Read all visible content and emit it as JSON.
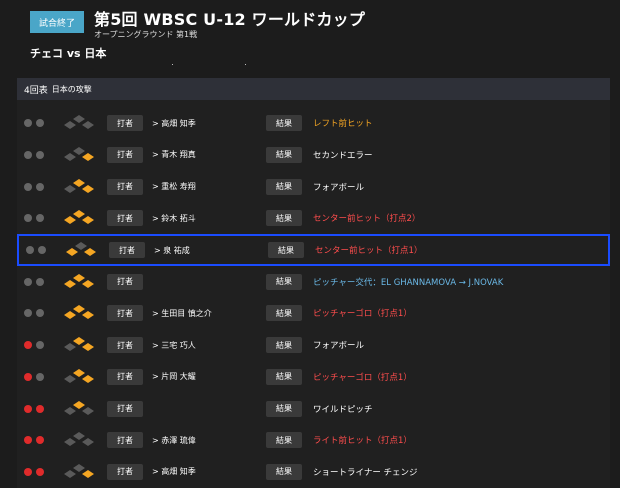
{
  "header": {
    "status": "試合終了",
    "title": "第5回 WBSC U-12 ワールドカップ",
    "subtitle": "オープニングラウンド 第1戦",
    "matchup": "チェコ vs 日本"
  },
  "section": {
    "inning": "4回表",
    "attack": "日本の攻撃"
  },
  "labels": {
    "batter": "打者",
    "result": "結果"
  },
  "colors": {
    "hit_orange": "#f5a623",
    "red_text": "#ff4d4d",
    "blue_text": "#6ab8e6",
    "white_text": "#ffffff",
    "base_on": "#f5a623",
    "base_off": "#5a5a5a",
    "out_on": "#e02b2b",
    "out_off": "#666666"
  },
  "rows": [
    {
      "outs": 0,
      "bases": [
        0,
        0,
        0
      ],
      "batter": "> 高畑 知季",
      "result": "レフト前ヒット",
      "result_color": "#f5a623"
    },
    {
      "outs": 0,
      "bases": [
        1,
        0,
        0
      ],
      "batter": "> 青木 翔真",
      "result": "セカンドエラー",
      "result_color": "#ffffff"
    },
    {
      "outs": 0,
      "bases": [
        1,
        1,
        0
      ],
      "batter": "> 重松 寿翔",
      "result": "フォアボール",
      "result_color": "#ffffff"
    },
    {
      "outs": 0,
      "bases": [
        1,
        1,
        1
      ],
      "batter": "> 鈴木 拓斗",
      "result": "センター前ヒット（打点2）",
      "result_color": "#ff4d4d"
    },
    {
      "outs": 0,
      "bases": [
        1,
        0,
        1
      ],
      "batter": "> 泉 祐成",
      "result": "センター前ヒット（打点1）",
      "result_color": "#ff4d4d",
      "selected": true
    },
    {
      "outs": 0,
      "bases": [
        1,
        1,
        1
      ],
      "batter": "",
      "result": "ピッチャー交代：EL GHANNAMOVA → J.NOVAK",
      "result_color": "#6ab8e6"
    },
    {
      "outs": 0,
      "bases": [
        1,
        1,
        1
      ],
      "batter": "> 生田目 慎之介",
      "result": "ピッチャーゴロ（打点1）",
      "result_color": "#ff4d4d"
    },
    {
      "outs": 1,
      "bases": [
        1,
        1,
        0
      ],
      "batter": "> 三宅 巧人",
      "result": "フォアボール",
      "result_color": "#ffffff"
    },
    {
      "outs": 1,
      "bases": [
        1,
        1,
        0
      ],
      "batter": "> 片岡 大耀",
      "result": "ピッチャーゴロ（打点1）",
      "result_color": "#ff4d4d"
    },
    {
      "outs": 2,
      "bases": [
        0,
        1,
        0
      ],
      "batter": "",
      "result": "ワイルドピッチ",
      "result_color": "#ffffff"
    },
    {
      "outs": 2,
      "bases": [
        0,
        0,
        0
      ],
      "batter": "> 赤澤 琉偉",
      "result": "ライト前ヒット（打点1）",
      "result_color": "#ff4d4d"
    },
    {
      "outs": 2,
      "bases": [
        1,
        0,
        0
      ],
      "batter": "> 高畑 知季",
      "result": "ショートライナー チェンジ",
      "result_color": "#ffffff"
    }
  ]
}
